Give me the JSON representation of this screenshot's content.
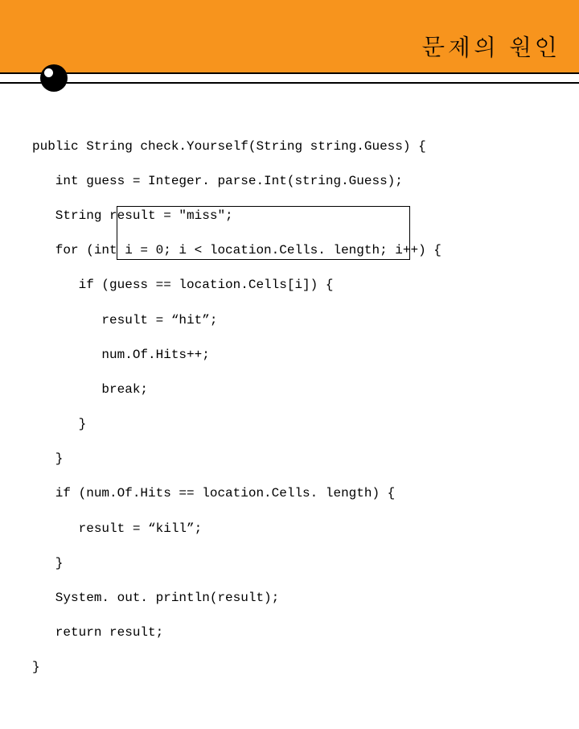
{
  "header": {
    "title": "문제의 원인"
  },
  "code": {
    "lines": [
      "public String check.Yourself(String string.Guess) {",
      "   int guess = Integer. parse.Int(string.Guess);",
      "   String result = \"miss\";",
      "   for (int i = 0; i < location.Cells. length; i++) {",
      "      if (guess == location.Cells[i]) {",
      "         result = “hit”;",
      "         num.Of.Hits++;",
      "         break;",
      "      }",
      "   }",
      "   if (num.Of.Hits == location.Cells. length) {",
      "      result = “kill”;",
      "   }",
      "   System. out. println(result);",
      "   return result;",
      "}"
    ]
  }
}
